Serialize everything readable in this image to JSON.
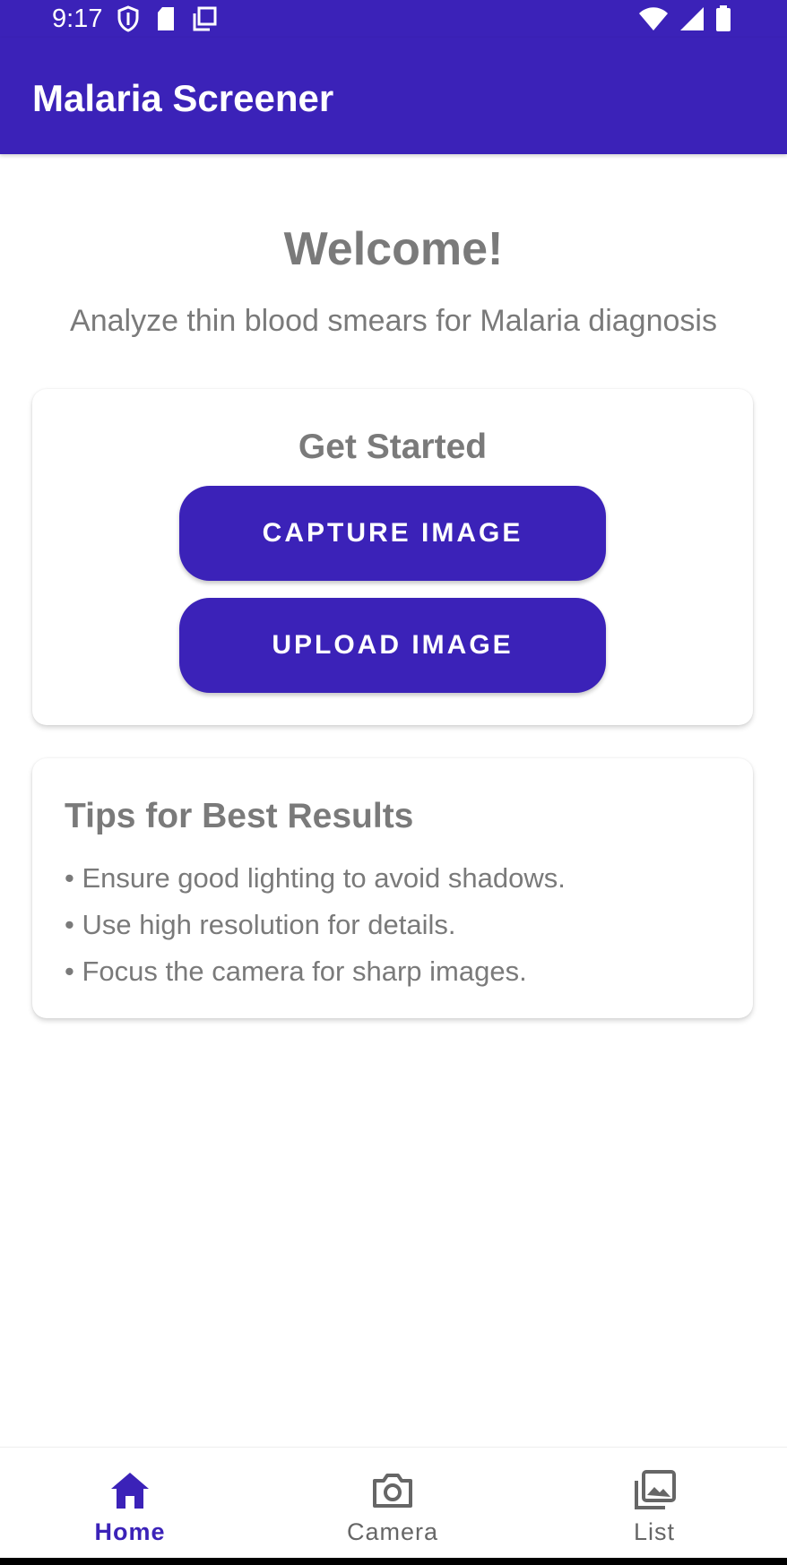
{
  "status_bar": {
    "time": "9:17",
    "icons": [
      "shield-icon",
      "sd-card-icon",
      "copy-icon",
      "wifi-icon",
      "signal-icon",
      "battery-icon"
    ]
  },
  "app_bar": {
    "title": "Malaria Screener"
  },
  "welcome": {
    "title": "Welcome!",
    "subtitle": "Analyze thin blood smears for Malaria diagnosis"
  },
  "get_started": {
    "title": "Get Started",
    "capture_label": "CAPTURE IMAGE",
    "upload_label": "UPLOAD IMAGE"
  },
  "tips": {
    "title": "Tips for Best Results",
    "items": [
      "• Ensure good lighting to avoid shadows.",
      "• Use high resolution for details.",
      "• Focus the camera for sharp images."
    ]
  },
  "bottom_nav": {
    "items": [
      {
        "label": "Home",
        "icon": "home-icon",
        "active": true
      },
      {
        "label": "Camera",
        "icon": "camera-icon",
        "active": false
      },
      {
        "label": "List",
        "icon": "gallery-icon",
        "active": false
      }
    ]
  },
  "colors": {
    "primary": "#3b22b8",
    "text_gray": "#7a7a7a",
    "background": "#ffffff"
  }
}
